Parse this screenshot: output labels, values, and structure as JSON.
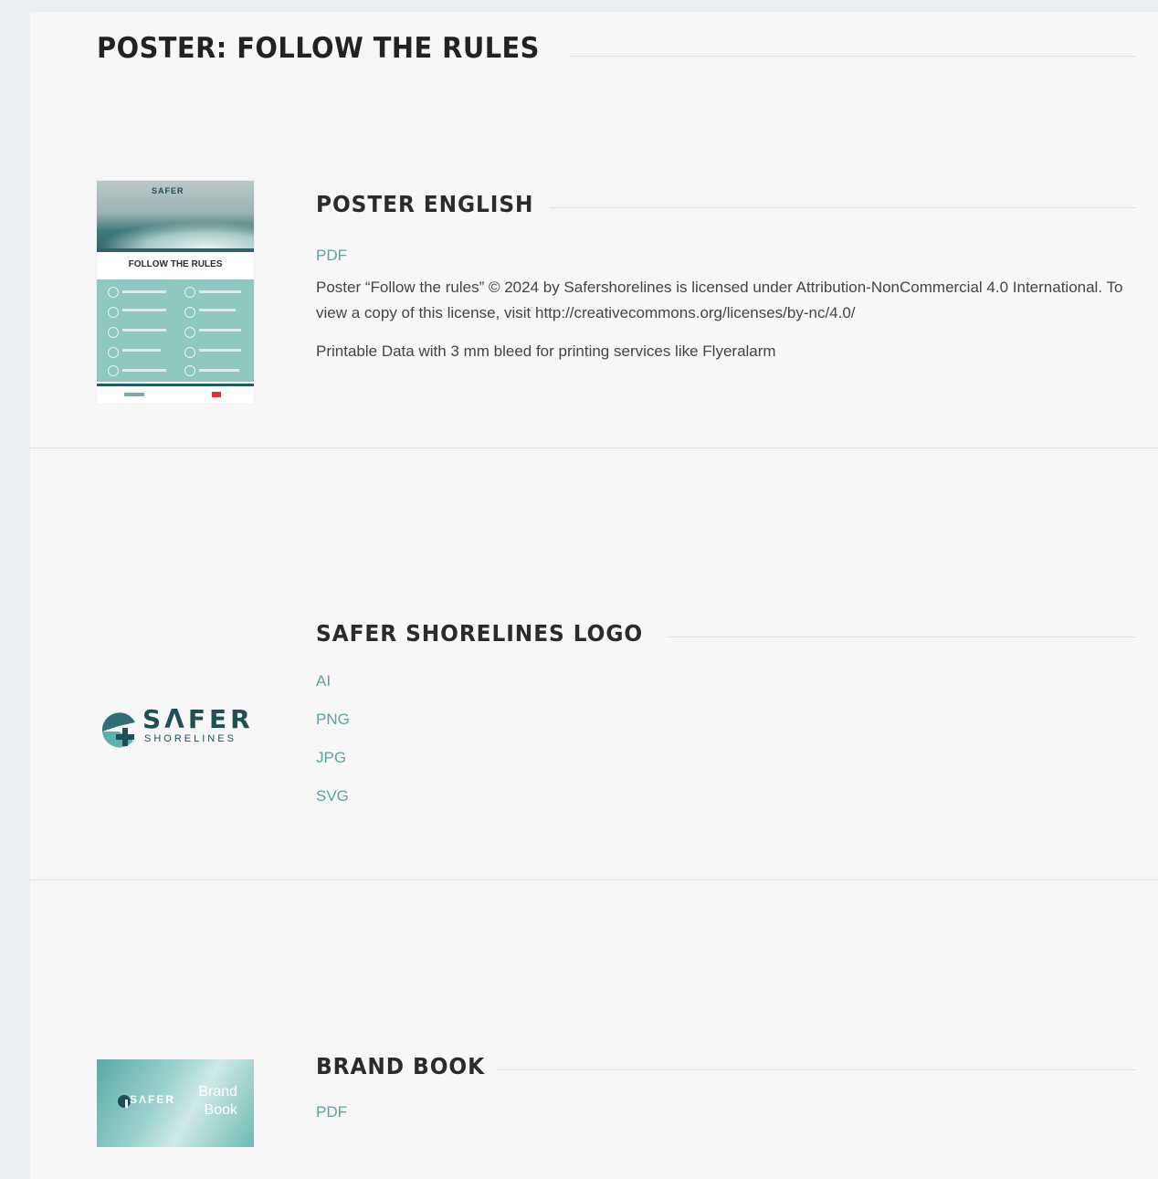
{
  "page": {
    "title": "POSTER: FOLLOW THE RULES"
  },
  "sections": [
    {
      "title": "POSTER ENGLISH",
      "links": [
        "PDF"
      ],
      "description": "Poster “Follow the rules” © 2024 by Safershorelines is licensed under Attribution-NonCommercial 4.0 International. To view a copy of this license, visit http://creativecommons.org/licenses/by-nc/4.0/",
      "note": "Printable Data with 3 mm bleed for printing services like Flyeralarm",
      "thumbnail": {
        "logo_text": "SAFER",
        "heading": "FOLLOW THE RULES"
      }
    },
    {
      "title": "SAFER SHORELINES LOGO",
      "links": [
        "AI",
        "PNG",
        "JPG",
        "SVG"
      ],
      "thumbnail": {
        "word": "SΛFER",
        "sub": "SHORELINES"
      }
    },
    {
      "title": "BRAND BOOK",
      "links": [
        "PDF"
      ],
      "thumbnail": {
        "word": "SΛFER",
        "label_1": "Brand",
        "label_2": "Book"
      }
    }
  ],
  "colors": {
    "link": "#5aa3a0",
    "brand_dark": "#1f4f57",
    "panel": "#f7f7f7",
    "background": "#e9eef1"
  }
}
